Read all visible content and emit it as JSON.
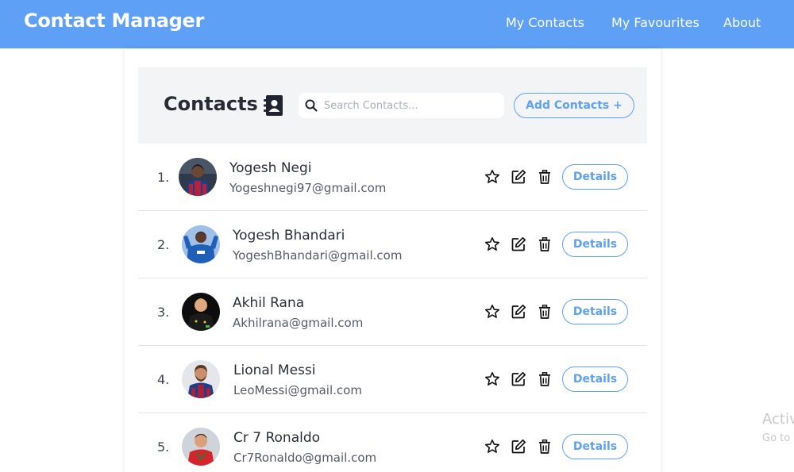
{
  "navbar": {
    "brand": "Contact Manager",
    "links": [
      "My Contacts",
      "My Favourites",
      "About"
    ]
  },
  "header": {
    "title": "Contacts",
    "search_placeholder": "Search Contacts...",
    "add_label": "Add Contacts +"
  },
  "contacts": [
    {
      "index": "1.",
      "name": "Yogesh Negi",
      "email": "Yogeshnegi97@gmail.com",
      "details_label": "Details"
    },
    {
      "index": "2.",
      "name": "Yogesh Bhandari",
      "email": "YogeshBhandari@gmail.com",
      "details_label": "Details"
    },
    {
      "index": "3.",
      "name": "Akhil Rana",
      "email": "Akhilrana@gmail.com",
      "details_label": "Details"
    },
    {
      "index": "4.",
      "name": "Lional Messi",
      "email": "LeoMessi@gmail.com",
      "details_label": "Details"
    },
    {
      "index": "5.",
      "name": "Cr 7 Ronaldo",
      "email": "Cr7Ronaldo@gmail.com",
      "details_label": "Details"
    }
  ],
  "watermark": {
    "line1": "Activ",
    "line2": "Go to"
  },
  "colors": {
    "accent": "#5ea0f5",
    "header_bg": "#f3f4f6"
  }
}
